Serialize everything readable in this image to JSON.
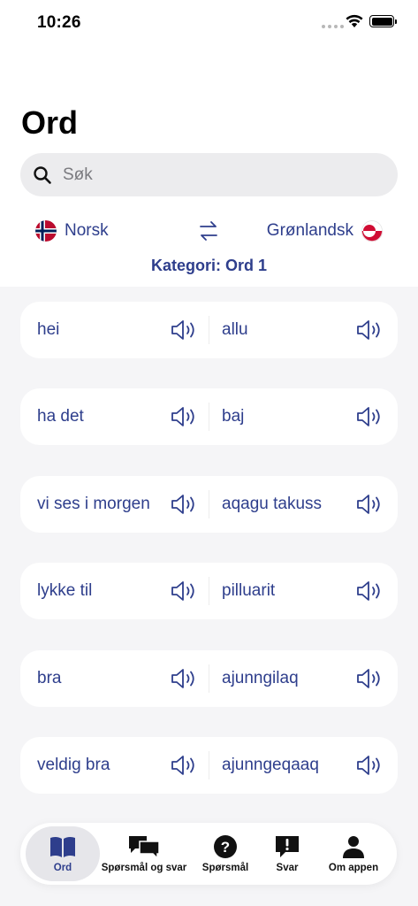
{
  "status_bar": {
    "time": "10:26"
  },
  "header": {
    "title": "Ord"
  },
  "search": {
    "placeholder": "Søk",
    "value": ""
  },
  "languages": {
    "source": "Norsk",
    "target": "Grønlandsk"
  },
  "category": {
    "label": "Kategori: Ord 1"
  },
  "words": [
    {
      "norsk": "hei",
      "gronlandsk": "allu"
    },
    {
      "norsk": "ha det",
      "gronlandsk": "baj"
    },
    {
      "norsk": "vi ses i morgen",
      "gronlandsk": "aqagu takuss"
    },
    {
      "norsk": "lykke til",
      "gronlandsk": "pilluarit"
    },
    {
      "norsk": "bra",
      "gronlandsk": "ajunngilaq"
    },
    {
      "norsk": "veldig bra",
      "gronlandsk": "ajunngeqaaq"
    }
  ],
  "tabs": [
    {
      "label": "Ord",
      "icon": "book-icon",
      "active": true
    },
    {
      "label": "Spørsmål og svar",
      "icon": "chat-bubbles-icon",
      "active": false
    },
    {
      "label": "Spørsmål",
      "icon": "question-icon",
      "active": false
    },
    {
      "label": "Svar",
      "icon": "exclamation-bubble-icon",
      "active": false
    },
    {
      "label": "Om appen",
      "icon": "person-icon",
      "active": false
    }
  ],
  "colors": {
    "accent": "#2e3e8c",
    "background": "#f5f5f7",
    "card": "#ffffff"
  }
}
